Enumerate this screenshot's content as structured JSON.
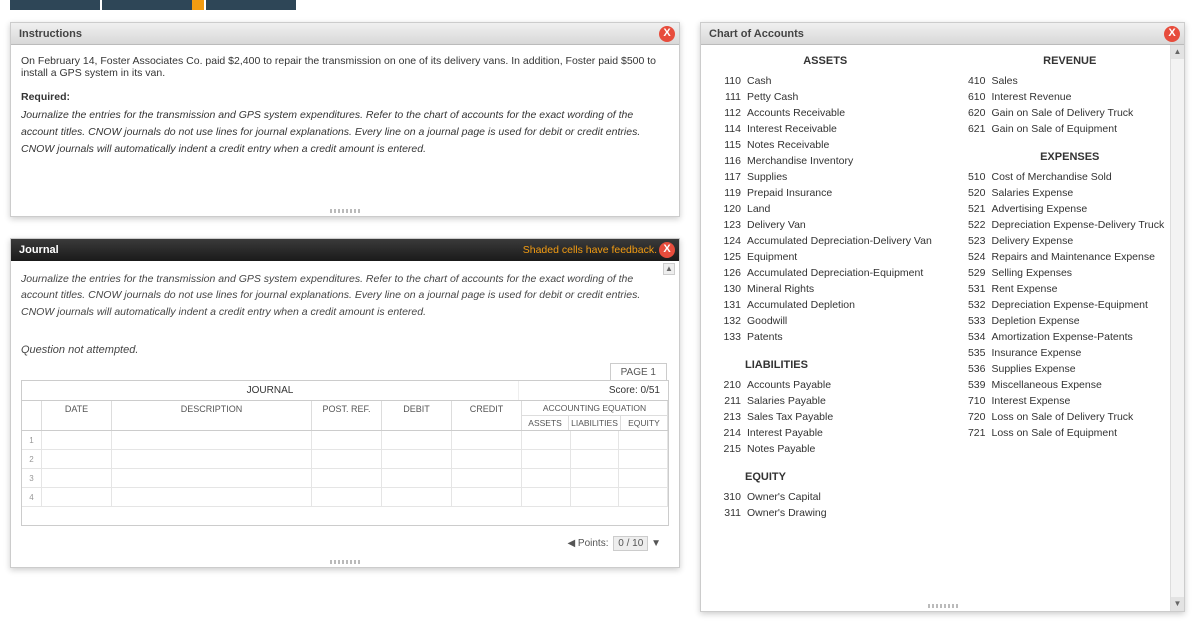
{
  "instructions": {
    "title": "Instructions",
    "body": "On February 14, Foster Associates Co. paid $2,400 to repair the transmission on one of its delivery vans. In addition, Foster paid $500 to install a GPS system in its van.",
    "required_label": "Required:",
    "required_text": "Journalize the entries for the transmission and GPS system expenditures. Refer to the chart of accounts for the exact wording of the account titles. CNOW journals do not use lines for journal explanations. Every line on a journal page is used for debit or credit entries. CNOW journals will automatically indent a credit entry when a credit amount is entered."
  },
  "journal": {
    "title": "Journal",
    "feedback": "Shaded cells have feedback.",
    "body": "Journalize the entries for the transmission and GPS system expenditures. Refer to the chart of accounts for the exact wording of the account titles. CNOW journals do not use lines for journal explanations. Every line on a journal page is used for debit or credit entries. CNOW journals will automatically indent a credit entry when a credit amount is entered.",
    "not_attempted": "Question not attempted.",
    "page_tab": "PAGE 1",
    "table_title": "JOURNAL",
    "score_label": "Score: 0/51",
    "headers": {
      "date": "DATE",
      "description": "DESCRIPTION",
      "postref": "POST. REF.",
      "debit": "DEBIT",
      "credit": "CREDIT",
      "ae_top": "ACCOUNTING EQUATION",
      "assets": "ASSETS",
      "liabilities": "LIABILITIES",
      "equity": "EQUITY"
    },
    "rows": [
      "1",
      "2",
      "3",
      "4"
    ],
    "points_label": "Points:",
    "points_value": "0 / 10"
  },
  "coa": {
    "title": "Chart of Accounts",
    "sections": {
      "assets_h": "ASSETS",
      "revenue_h": "REVENUE",
      "expenses_h": "EXPENSES",
      "liabilities_h": "LIABILITIES",
      "equity_h": "EQUITY"
    },
    "assets": [
      {
        "n": "110",
        "t": "Cash"
      },
      {
        "n": "111",
        "t": "Petty Cash"
      },
      {
        "n": "112",
        "t": "Accounts Receivable"
      },
      {
        "n": "114",
        "t": "Interest Receivable"
      },
      {
        "n": "115",
        "t": "Notes Receivable"
      },
      {
        "n": "116",
        "t": "Merchandise Inventory"
      },
      {
        "n": "117",
        "t": "Supplies"
      },
      {
        "n": "119",
        "t": "Prepaid Insurance"
      },
      {
        "n": "120",
        "t": "Land"
      },
      {
        "n": "123",
        "t": "Delivery Van"
      },
      {
        "n": "124",
        "t": "Accumulated Depreciation-Delivery Van"
      },
      {
        "n": "125",
        "t": "Equipment"
      },
      {
        "n": "126",
        "t": "Accumulated Depreciation-Equipment"
      },
      {
        "n": "130",
        "t": "Mineral Rights"
      },
      {
        "n": "131",
        "t": "Accumulated Depletion"
      },
      {
        "n": "132",
        "t": "Goodwill"
      },
      {
        "n": "133",
        "t": "Patents"
      }
    ],
    "revenue": [
      {
        "n": "410",
        "t": "Sales"
      },
      {
        "n": "610",
        "t": "Interest Revenue"
      },
      {
        "n": "620",
        "t": "Gain on Sale of Delivery Truck"
      },
      {
        "n": "621",
        "t": "Gain on Sale of Equipment"
      }
    ],
    "expenses": [
      {
        "n": "510",
        "t": "Cost of Merchandise Sold"
      },
      {
        "n": "520",
        "t": "Salaries Expense"
      },
      {
        "n": "521",
        "t": "Advertising Expense"
      },
      {
        "n": "522",
        "t": "Depreciation Expense-Delivery Truck"
      },
      {
        "n": "523",
        "t": "Delivery Expense"
      },
      {
        "n": "524",
        "t": "Repairs and Maintenance Expense"
      },
      {
        "n": "529",
        "t": "Selling Expenses"
      },
      {
        "n": "531",
        "t": "Rent Expense"
      },
      {
        "n": "532",
        "t": "Depreciation Expense-Equipment"
      },
      {
        "n": "533",
        "t": "Depletion Expense"
      },
      {
        "n": "534",
        "t": "Amortization Expense-Patents"
      },
      {
        "n": "535",
        "t": "Insurance Expense"
      },
      {
        "n": "536",
        "t": "Supplies Expense"
      },
      {
        "n": "539",
        "t": "Miscellaneous Expense"
      },
      {
        "n": "710",
        "t": "Interest Expense"
      },
      {
        "n": "720",
        "t": "Loss on Sale of Delivery Truck"
      },
      {
        "n": "721",
        "t": "Loss on Sale of Equipment"
      }
    ],
    "liabilities": [
      {
        "n": "210",
        "t": "Accounts Payable"
      },
      {
        "n": "211",
        "t": "Salaries Payable"
      },
      {
        "n": "213",
        "t": "Sales Tax Payable"
      },
      {
        "n": "214",
        "t": "Interest Payable"
      },
      {
        "n": "215",
        "t": "Notes Payable"
      }
    ],
    "equity": [
      {
        "n": "310",
        "t": "Owner's Capital"
      },
      {
        "n": "311",
        "t": "Owner's Drawing"
      }
    ]
  }
}
